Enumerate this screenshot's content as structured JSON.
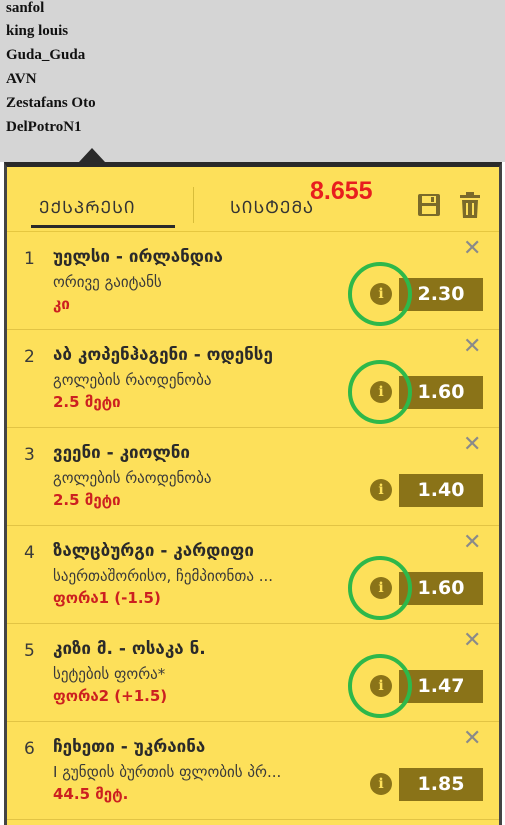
{
  "usernames": [
    "sanfol",
    "king louis",
    "Guda_Guda",
    "AVN",
    "Zestafans Oto",
    "DelPotroN1"
  ],
  "tabs": {
    "express": "ᲔᲥᲡᲞᲠᲔᲡᲘ",
    "system": "ᲡᲘᲡᲢᲔᲛᲐ"
  },
  "total_odds": "8.655",
  "icons": {
    "save": "save-icon",
    "trash": "trash-icon",
    "info": "info-icon",
    "close": "close-icon"
  },
  "colors": {
    "panel": "#fde05a",
    "odds_box": "#8a7318",
    "pick_text": "#cc2020",
    "total_odds": "#e81e1e",
    "highlight_ring": "#2eb84a"
  },
  "bets": [
    {
      "num": "1",
      "title": "უელსი - ირლანდია",
      "market": "ორივე გაიტანს",
      "pick": "კი",
      "odds": "2.30",
      "highlighted": true
    },
    {
      "num": "2",
      "title": "აბ კოპენჰაგენი - ოდენსე",
      "market": "გოლების რაოდენობა",
      "pick": "2.5 მეტი",
      "odds": "1.60",
      "highlighted": true
    },
    {
      "num": "3",
      "title": "ვეენი - კიოლნი",
      "market": "გოლების რაოდენობა",
      "pick": "2.5 მეტი",
      "odds": "1.40",
      "highlighted": false
    },
    {
      "num": "4",
      "title": "ზალცბურგი - კარდიფი",
      "market": "საერთაშორისო, ჩემპიონთა ...",
      "pick": "ფორა1 (-1.5)",
      "odds": "1.60",
      "highlighted": true
    },
    {
      "num": "5",
      "title": "კიზი მ. - ოსაკა ნ.",
      "market": "სეტების ფორა*",
      "pick": "ფორა2 (+1.5)",
      "odds": "1.47",
      "highlighted": true
    },
    {
      "num": "6",
      "title": "ჩეხეთი - უკრაინა",
      "market": "I გუნდის ბურთის ფლობის პრ...",
      "pick": "44.5 მეტ.",
      "odds": "1.85",
      "highlighted": false
    }
  ]
}
